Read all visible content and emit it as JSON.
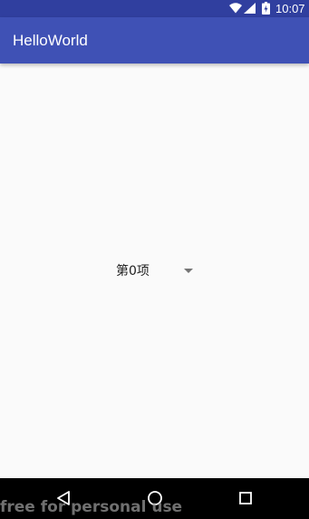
{
  "status_bar": {
    "time": "10:07",
    "background_color": "#303f9f",
    "icons": [
      "wifi-icon",
      "cellular-signal-icon",
      "battery-charging-icon"
    ]
  },
  "app_bar": {
    "title": "HelloWorld",
    "background_color": "#3f51b5"
  },
  "main": {
    "spinner": {
      "selected_value": "第0项",
      "icon": "dropdown-arrow-icon"
    }
  },
  "nav_bar": {
    "background_color": "#000000",
    "buttons": [
      "back-icon",
      "home-icon",
      "recents-icon"
    ]
  },
  "watermark": {
    "text": "free for personal use"
  }
}
